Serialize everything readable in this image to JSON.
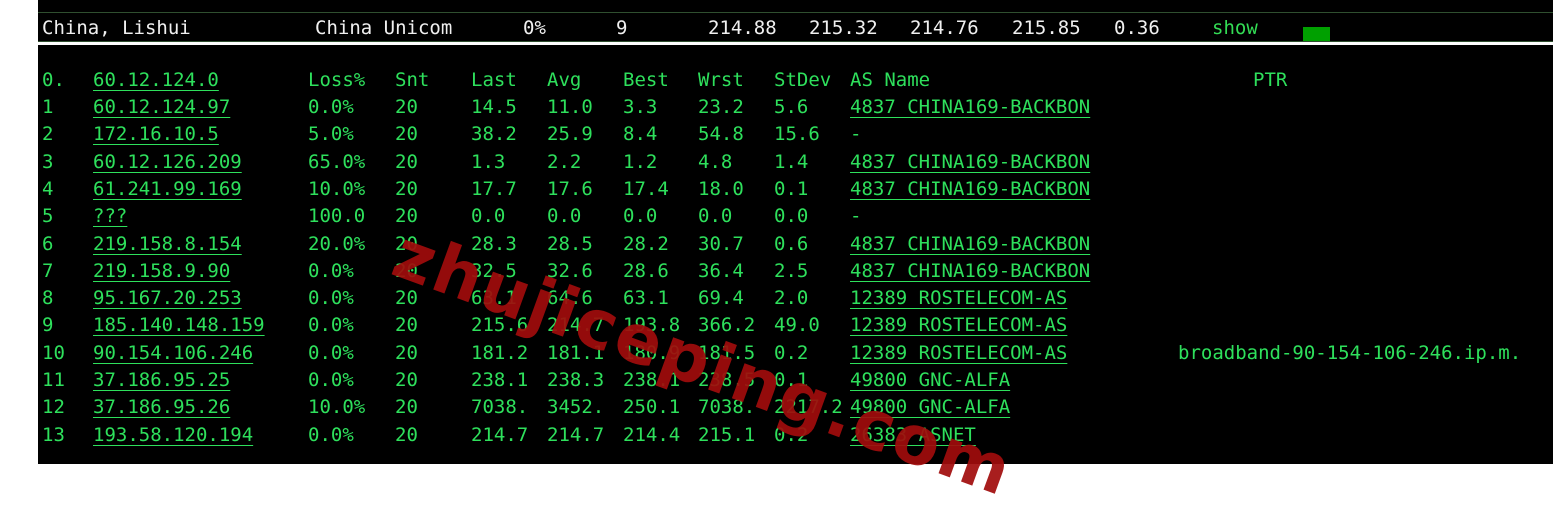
{
  "summary": {
    "location": "China, Lishui",
    "isp": "China Unicom",
    "loss": "0%",
    "sent": "9",
    "last": "214.88",
    "avg": "215.32",
    "best": "214.76",
    "worst": "215.85",
    "stdev": "0.36",
    "show_label": "show",
    "status_color": "#00a000"
  },
  "header": {
    "hop": "0.",
    "host": "60.12.124.0",
    "loss": "Loss%",
    "snt": "Snt",
    "last": "Last",
    "avg": "Avg",
    "best": "Best",
    "wrst": "Wrst",
    "stdev": "StDev",
    "asname": "AS Name",
    "ptr": "PTR"
  },
  "hops": [
    {
      "hop": "1",
      "host": "60.12.124.97",
      "loss": "0.0%",
      "snt": "20",
      "last": "14.5",
      "avg": "11.0",
      "best": "3.3",
      "wrst": "23.2",
      "stdev": "5.6",
      "as": "4837  CHINA169-BACKBON",
      "ptr": ""
    },
    {
      "hop": "2",
      "host": "172.16.10.5",
      "loss": "5.0%",
      "snt": "20",
      "last": "38.2",
      "avg": "25.9",
      "best": "8.4",
      "wrst": "54.8",
      "stdev": "15.6",
      "as": "-",
      "ptr": ""
    },
    {
      "hop": "3",
      "host": "60.12.126.209",
      "loss": "65.0%",
      "snt": "20",
      "last": "1.3",
      "avg": "2.2",
      "best": "1.2",
      "wrst": "4.8",
      "stdev": "1.4",
      "as": "4837  CHINA169-BACKBON",
      "ptr": ""
    },
    {
      "hop": "4",
      "host": "61.241.99.169",
      "loss": "10.0%",
      "snt": "20",
      "last": "17.7",
      "avg": "17.6",
      "best": "17.4",
      "wrst": "18.0",
      "stdev": "0.1",
      "as": "4837  CHINA169-BACKBON",
      "ptr": ""
    },
    {
      "hop": "5",
      "host": "???",
      "loss": "100.0",
      "snt": "20",
      "last": "0.0",
      "avg": "0.0",
      "best": "0.0",
      "wrst": "0.0",
      "stdev": "0.0",
      "as": "-",
      "ptr": ""
    },
    {
      "hop": "6",
      "host": "219.158.8.154",
      "loss": "20.0%",
      "snt": "20",
      "last": "28.3",
      "avg": "28.5",
      "best": "28.2",
      "wrst": "30.7",
      "stdev": "0.6",
      "as": "4837  CHINA169-BACKBON",
      "ptr": ""
    },
    {
      "hop": "7",
      "host": "219.158.9.90",
      "loss": "0.0%",
      "snt": "20",
      "last": "32.5",
      "avg": "32.6",
      "best": "28.6",
      "wrst": "36.4",
      "stdev": "2.5",
      "as": "4837  CHINA169-BACKBON",
      "ptr": ""
    },
    {
      "hop": "8",
      "host": "95.167.20.253",
      "loss": "0.0%",
      "snt": "20",
      "last": "63.1",
      "avg": "64.6",
      "best": "63.1",
      "wrst": "69.4",
      "stdev": "2.0",
      "as": "12389 ROSTELECOM-AS",
      "ptr": ""
    },
    {
      "hop": "9",
      "host": "185.140.148.159",
      "loss": "0.0%",
      "snt": "20",
      "last": "215.6",
      "avg": "214.7",
      "best": "193.8",
      "wrst": "366.2",
      "stdev": "49.0",
      "as": "12389 ROSTELECOM-AS",
      "ptr": ""
    },
    {
      "hop": "10",
      "host": "90.154.106.246",
      "loss": "0.0%",
      "snt": "20",
      "last": "181.2",
      "avg": "181.1",
      "best": "180.9",
      "wrst": "181.5",
      "stdev": "0.2",
      "as": "12389 ROSTELECOM-AS",
      "ptr": "broadband-90-154-106-246.ip.m."
    },
    {
      "hop": "11",
      "host": "37.186.95.25",
      "loss": "0.0%",
      "snt": "20",
      "last": "238.1",
      "avg": "238.3",
      "best": "238.1",
      "wrst": "238.5",
      "stdev": "0.1",
      "as": "49800 GNC-ALFA",
      "ptr": ""
    },
    {
      "hop": "12",
      "host": "37.186.95.26",
      "loss": "10.0%",
      "snt": "20",
      "last": "7038.",
      "avg": "3452.",
      "best": "250.1",
      "wrst": "7038.",
      "stdev": "2217.2",
      "as": "49800 GNC-ALFA",
      "ptr": ""
    },
    {
      "hop": "13",
      "host": "193.58.120.194",
      "loss": "0.0%",
      "snt": "20",
      "last": "214.7",
      "avg": "214.7",
      "best": "214.4",
      "wrst": "215.1",
      "stdev": "0.2",
      "as": "26383 ASNET",
      "ptr": ""
    }
  ],
  "watermark": "zhujiceping.com",
  "colors": {
    "terminal_bg": "#000000",
    "text_green": "#2ee05c",
    "watermark": "#a10c0c"
  }
}
